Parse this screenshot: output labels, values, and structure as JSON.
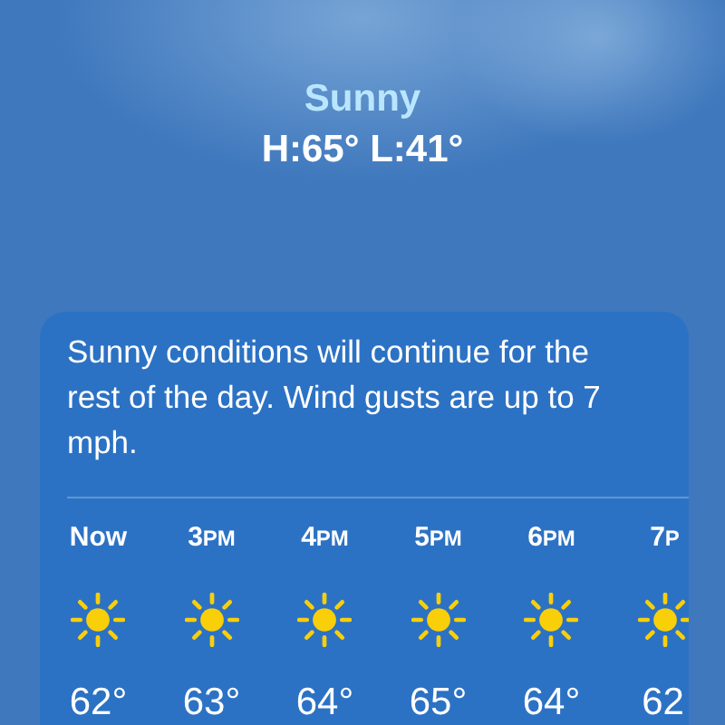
{
  "current": {
    "condition": "Sunny",
    "high_low": "H:65°  L:41°"
  },
  "forecast_card": {
    "summary": "Sunny conditions will continue for the rest of the day. Wind gusts are up to 7 mph.",
    "hours": [
      {
        "hour": "Now",
        "temp": "62°"
      },
      {
        "hour": "3",
        "suffix": "PM",
        "temp": "63°"
      },
      {
        "hour": "4",
        "suffix": "PM",
        "temp": "64°"
      },
      {
        "hour": "5",
        "suffix": "PM",
        "temp": "65°"
      },
      {
        "hour": "6",
        "suffix": "PM",
        "temp": "64°"
      },
      {
        "hour": "7",
        "suffix": "P",
        "temp": "62"
      }
    ]
  }
}
